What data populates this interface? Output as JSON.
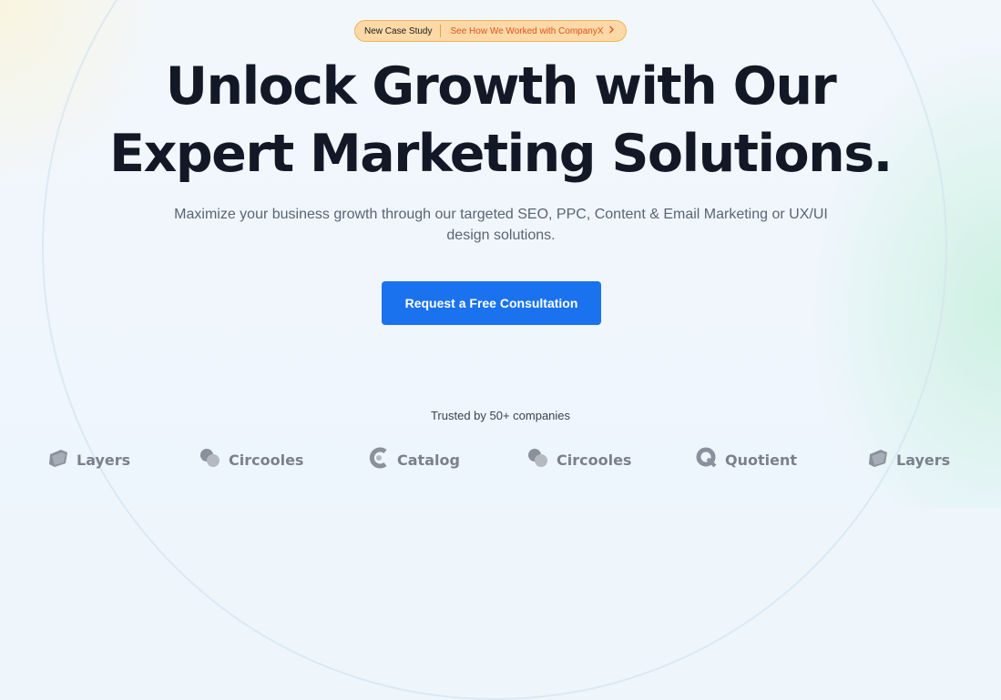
{
  "badge": {
    "label": "New Case Study",
    "link_text": "See How We Worked with CompanyX",
    "chevron_icon": "chevron-right-icon"
  },
  "hero": {
    "headline_line1": "Unlock Growth with Our",
    "headline_line2": "Expert Marketing Solutions.",
    "subheadline_line1": "Maximize your business growth through our targeted SEO, PPC, Content & Email Marketing or UX/UI",
    "subheadline_line2": "design solutions.",
    "cta_label": "Request a Free Consultation"
  },
  "trusted": {
    "text": "Trusted by 50+ companies",
    "logos": [
      {
        "name": "Layers",
        "icon": "layers-icon"
      },
      {
        "name": "Circooles",
        "icon": "circooles-icon"
      },
      {
        "name": "Catalog",
        "icon": "catalog-icon"
      },
      {
        "name": "Circooles",
        "icon": "circooles-icon"
      },
      {
        "name": "Quotient",
        "icon": "quotient-icon"
      },
      {
        "name": "Layers",
        "icon": "layers-icon"
      }
    ]
  },
  "colors": {
    "accent": "#1a72ef",
    "badge_background": "#fcd9a6",
    "badge_link": "#e0531d",
    "heading": "#121826"
  }
}
